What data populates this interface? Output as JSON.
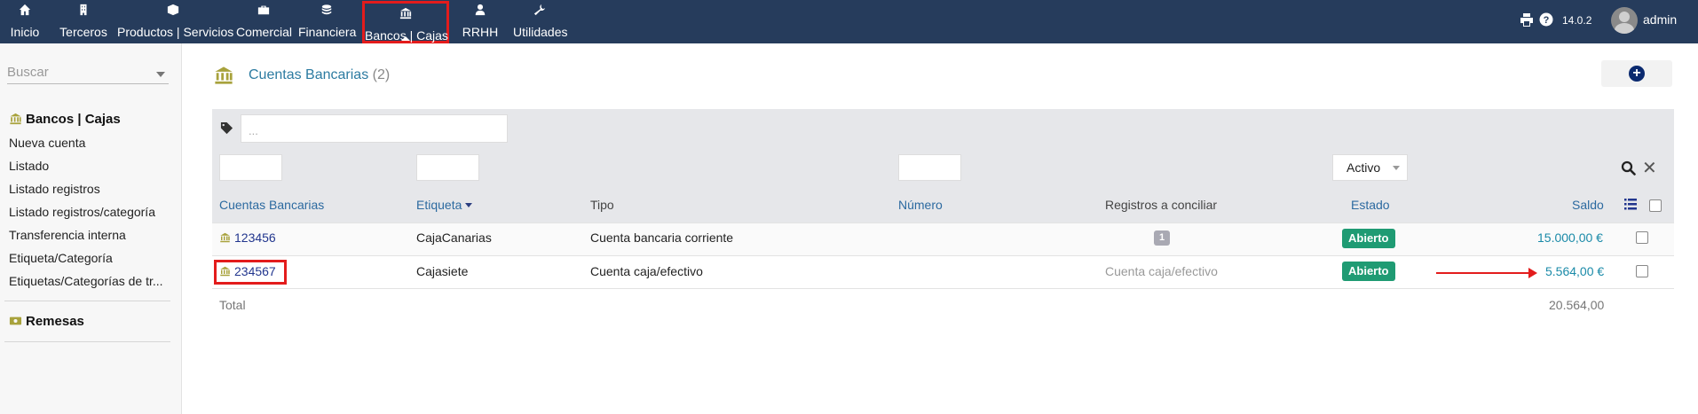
{
  "topnav": {
    "items": [
      {
        "label": "Inicio",
        "icon": "home-icon"
      },
      {
        "label": "Terceros",
        "icon": "building-icon"
      },
      {
        "label": "Productos | Servicios",
        "icon": "cube-icon"
      },
      {
        "label": "Comercial",
        "icon": "briefcase-icon"
      },
      {
        "label": "Financiera",
        "icon": "coins-icon"
      },
      {
        "label": "Bancos | Cajas",
        "icon": "bank-icon",
        "active": true
      },
      {
        "label": "RRHH",
        "icon": "user-tie-icon"
      },
      {
        "label": "Utilidades",
        "icon": "wrench-icon"
      }
    ],
    "version": "14.0.2",
    "user": "admin"
  },
  "sidebar": {
    "search_placeholder": "Buscar",
    "section_title": "Bancos | Cajas",
    "links": [
      "Nueva cuenta",
      "Listado",
      "Listado registros",
      "Listado registros/categoría",
      "Transferencia interna",
      "Etiqueta/Categoría",
      "Etiquetas/Categorías de tr..."
    ],
    "section2_title": "Remesas"
  },
  "page": {
    "title": "Cuentas Bancarias",
    "count": "(2)"
  },
  "filters": {
    "tag_placeholder": "...",
    "estado_value": "Activo"
  },
  "table": {
    "headers": {
      "cuenta": "Cuentas Bancarias",
      "etiqueta": "Etiqueta",
      "tipo": "Tipo",
      "numero": "Número",
      "registros": "Registros a conciliar",
      "estado": "Estado",
      "saldo": "Saldo"
    },
    "rows": [
      {
        "cuenta": "123456",
        "etiqueta": "CajaCanarias",
        "tipo": "Cuenta bancaria corriente",
        "numero": "",
        "registros": "1",
        "estado": "Abierto",
        "saldo": "15.000,00 €"
      },
      {
        "cuenta": "234567",
        "etiqueta": "Cajasiete",
        "tipo": "Cuenta caja/efectivo",
        "numero": "",
        "registros": "Cuenta caja/efectivo",
        "estado": "Abierto",
        "saldo": "5.564,00 €"
      }
    ],
    "total_label": "Total",
    "total_value": "20.564,00"
  },
  "colors": {
    "topbar": "#263c5c",
    "accent_green": "#1f9b73",
    "highlight_red": "#e31c1c",
    "icon_gold": "#a8a23c"
  }
}
